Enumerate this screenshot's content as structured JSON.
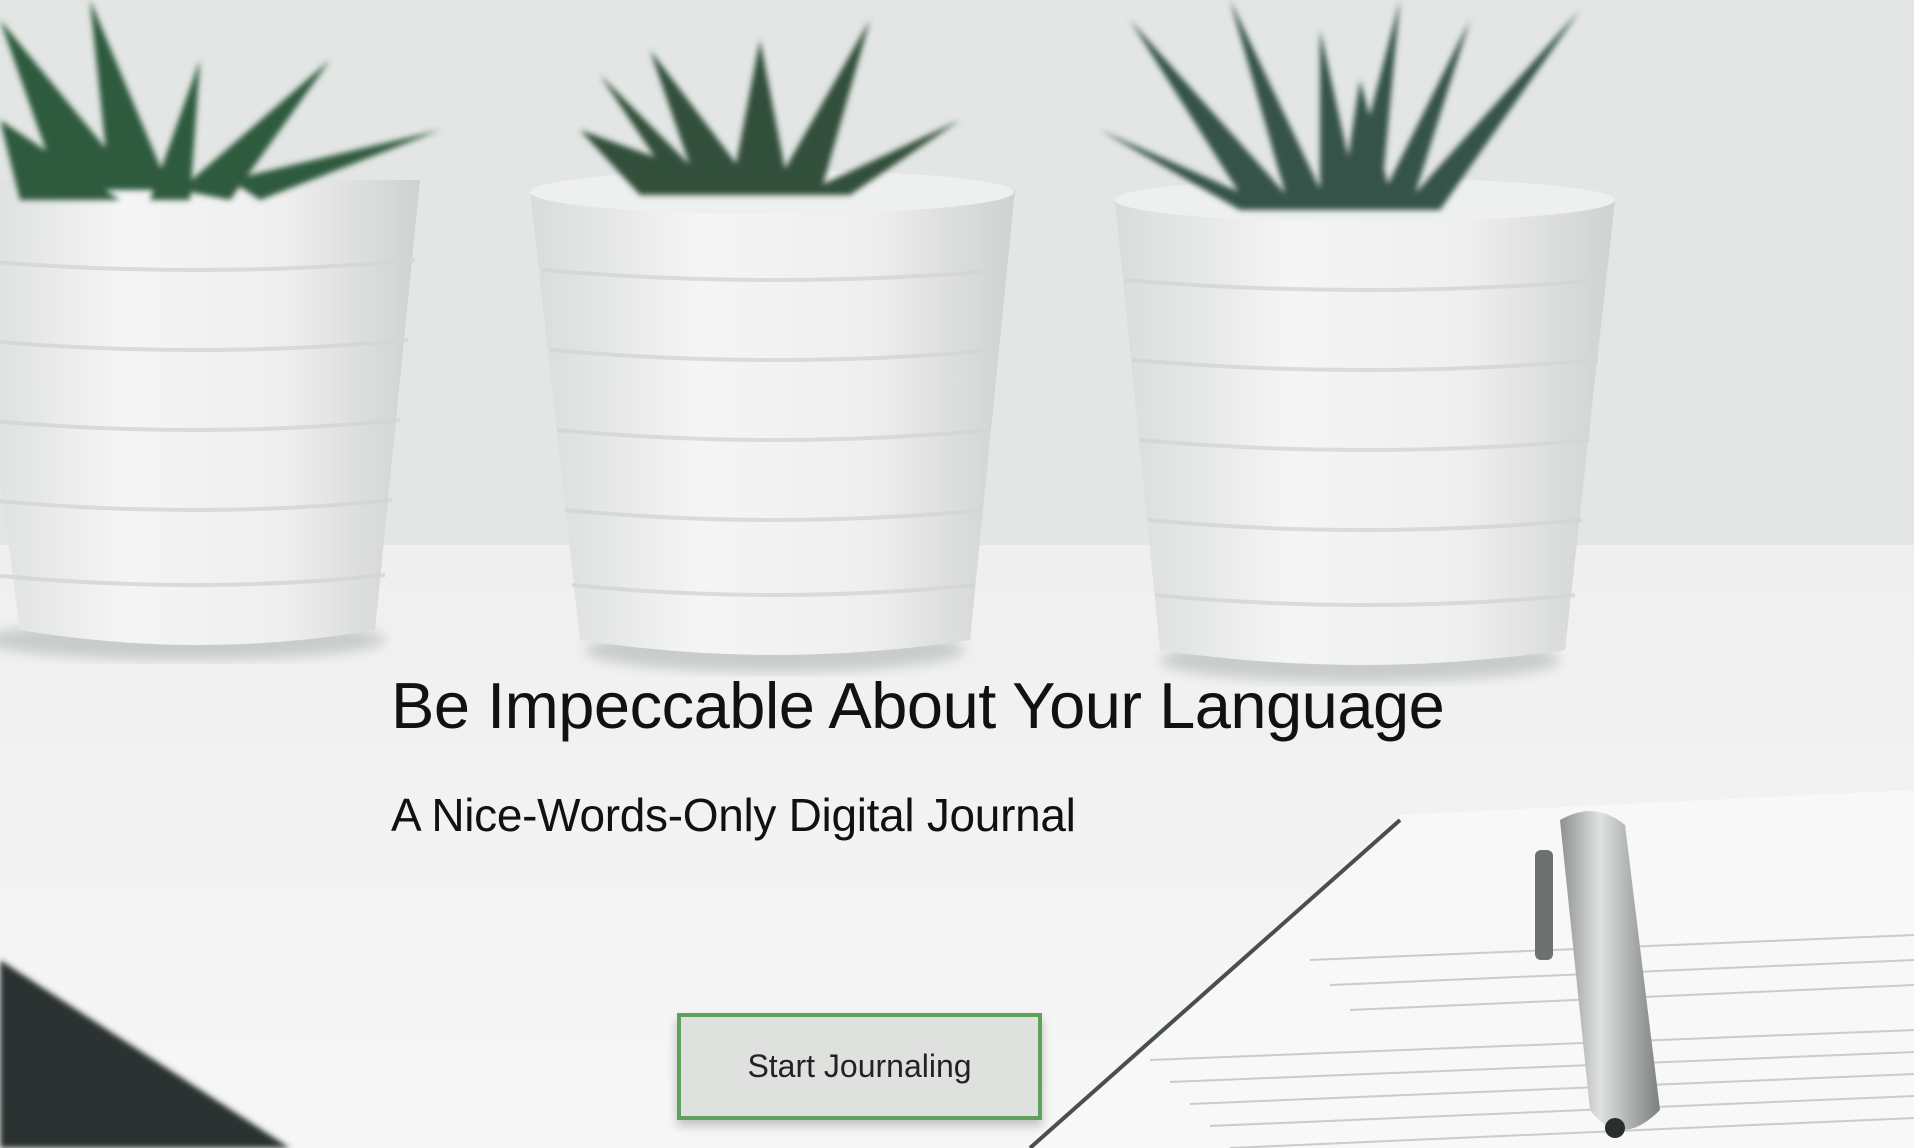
{
  "hero": {
    "headline": "Be Impeccable About Your Language",
    "subheadline": "A Nice-Words-Only Digital Journal",
    "cta_label": "Start Journaling",
    "accent_color": "#5fa05a",
    "background_image_icon": "succulent-plants-photo"
  }
}
